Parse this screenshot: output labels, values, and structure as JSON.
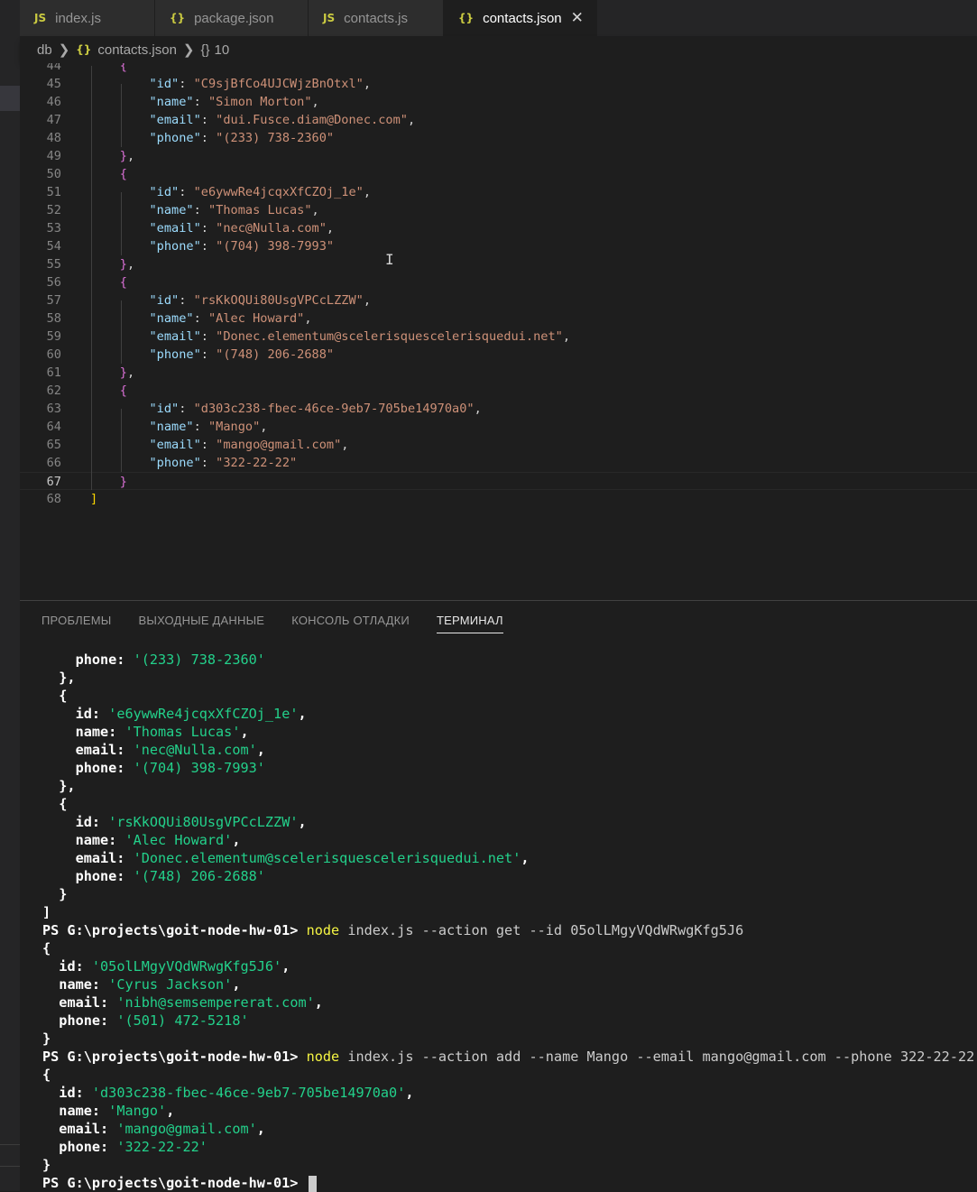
{
  "tabs": [
    {
      "icon": "JS",
      "label": "index.js",
      "active": false
    },
    {
      "icon": "{}",
      "label": "package.json",
      "active": false
    },
    {
      "icon": "JS",
      "label": "contacts.js",
      "active": false
    },
    {
      "icon": "{}",
      "label": "contacts.json",
      "active": true
    }
  ],
  "breadcrumb": {
    "folder": "db",
    "file": "contacts.json",
    "symbol_icon": "{}",
    "symbol": "10"
  },
  "editor": {
    "active_line": 67,
    "lines": [
      {
        "n": 44,
        "text": "{",
        "indent": 1
      },
      {
        "n": 45,
        "key": "id",
        "value": "C9sjBfCo4UJCWjzBnOtxl",
        "comma": true
      },
      {
        "n": 46,
        "key": "name",
        "value": "Simon Morton",
        "comma": true
      },
      {
        "n": 47,
        "key": "email",
        "value": "dui.Fusce.diam@Donec.com",
        "comma": true
      },
      {
        "n": 48,
        "key": "phone",
        "value": "(233) 738-2360",
        "comma": false
      },
      {
        "n": 49,
        "text": "},",
        "indent": 1
      },
      {
        "n": 50,
        "text": "{",
        "indent": 1
      },
      {
        "n": 51,
        "key": "id",
        "value": "e6ywwRe4jcqxXfCZOj_1e",
        "comma": true
      },
      {
        "n": 52,
        "key": "name",
        "value": "Thomas Lucas",
        "comma": true
      },
      {
        "n": 53,
        "key": "email",
        "value": "nec@Nulla.com",
        "comma": true
      },
      {
        "n": 54,
        "key": "phone",
        "value": "(704) 398-7993",
        "comma": false
      },
      {
        "n": 55,
        "text": "},",
        "indent": 1
      },
      {
        "n": 56,
        "text": "{",
        "indent": 1
      },
      {
        "n": 57,
        "key": "id",
        "value": "rsKkOQUi80UsgVPCcLZZW",
        "comma": true
      },
      {
        "n": 58,
        "key": "name",
        "value": "Alec Howard",
        "comma": true
      },
      {
        "n": 59,
        "key": "email",
        "value": "Donec.elementum@scelerisquescelerisquedui.net",
        "comma": true
      },
      {
        "n": 60,
        "key": "phone",
        "value": "(748) 206-2688",
        "comma": false
      },
      {
        "n": 61,
        "text": "},",
        "indent": 1
      },
      {
        "n": 62,
        "text": "{",
        "indent": 1
      },
      {
        "n": 63,
        "key": "id",
        "value": "d303c238-fbec-46ce-9eb7-705be14970a0",
        "comma": true
      },
      {
        "n": 64,
        "key": "name",
        "value": "Mango",
        "comma": true
      },
      {
        "n": 65,
        "key": "email",
        "value": "mango@gmail.com",
        "comma": true
      },
      {
        "n": 66,
        "key": "phone",
        "value": "322-22-22",
        "comma": false
      },
      {
        "n": 67,
        "text": "}",
        "indent": 1
      },
      {
        "n": 68,
        "text": "]",
        "indent": 0
      }
    ]
  },
  "panel": {
    "tabs": [
      "ПРОБЛЕМЫ",
      "ВЫХОДНЫЕ ДАННЫЕ",
      "КОНСОЛЬ ОТЛАДКИ",
      "ТЕРМИНАЛ"
    ],
    "active_tab": "ТЕРМИНАЛ"
  },
  "terminal": {
    "lines": [
      {
        "type": "kv",
        "indent": "    ",
        "key": "phone",
        "value": "'(233) 738-2360'",
        "comma": false
      },
      {
        "type": "plain",
        "text": "  },"
      },
      {
        "type": "plain",
        "text": "  {"
      },
      {
        "type": "kv",
        "indent": "    ",
        "key": "id",
        "value": "'e6ywwRe4jcqxXfCZOj_1e'",
        "comma": true
      },
      {
        "type": "kv",
        "indent": "    ",
        "key": "name",
        "value": "'Thomas Lucas'",
        "comma": true
      },
      {
        "type": "kv",
        "indent": "    ",
        "key": "email",
        "value": "'nec@Nulla.com'",
        "comma": true
      },
      {
        "type": "kv",
        "indent": "    ",
        "key": "phone",
        "value": "'(704) 398-7993'",
        "comma": false
      },
      {
        "type": "plain",
        "text": "  },"
      },
      {
        "type": "plain",
        "text": "  {"
      },
      {
        "type": "kv",
        "indent": "    ",
        "key": "id",
        "value": "'rsKkOQUi80UsgVPCcLZZW'",
        "comma": true
      },
      {
        "type": "kv",
        "indent": "    ",
        "key": "name",
        "value": "'Alec Howard'",
        "comma": true
      },
      {
        "type": "kv",
        "indent": "    ",
        "key": "email",
        "value": "'Donec.elementum@scelerisquescelerisquedui.net'",
        "comma": true
      },
      {
        "type": "kv",
        "indent": "    ",
        "key": "phone",
        "value": "'(748) 206-2688'",
        "comma": false
      },
      {
        "type": "plain",
        "text": "  }"
      },
      {
        "type": "plain",
        "text": "]"
      },
      {
        "type": "prompt",
        "prompt": "PS G:\\projects\\goit-node-hw-01> ",
        "cmd": "node",
        "args": " index.js --action get --id 05olLMgyVQdWRwgKfg5J6"
      },
      {
        "type": "plain",
        "text": "{"
      },
      {
        "type": "kv",
        "indent": "  ",
        "key": "id",
        "value": "'05olLMgyVQdWRwgKfg5J6'",
        "comma": true
      },
      {
        "type": "kv",
        "indent": "  ",
        "key": "name",
        "value": "'Cyrus Jackson'",
        "comma": true
      },
      {
        "type": "kv",
        "indent": "  ",
        "key": "email",
        "value": "'nibh@semsempererat.com'",
        "comma": true
      },
      {
        "type": "kv",
        "indent": "  ",
        "key": "phone",
        "value": "'(501) 472-5218'",
        "comma": false
      },
      {
        "type": "plain",
        "text": "}"
      },
      {
        "type": "prompt",
        "prompt": "PS G:\\projects\\goit-node-hw-01> ",
        "cmd": "node",
        "args": " index.js --action add --name Mango --email mango@gmail.com --phone 322-22-22"
      },
      {
        "type": "plain",
        "text": "{"
      },
      {
        "type": "kv",
        "indent": "  ",
        "key": "id",
        "value": "'d303c238-fbec-46ce-9eb7-705be14970a0'",
        "comma": true
      },
      {
        "type": "kv",
        "indent": "  ",
        "key": "name",
        "value": "'Mango'",
        "comma": true
      },
      {
        "type": "kv",
        "indent": "  ",
        "key": "email",
        "value": "'mango@gmail.com'",
        "comma": true
      },
      {
        "type": "kv",
        "indent": "  ",
        "key": "phone",
        "value": "'322-22-22'",
        "comma": false
      },
      {
        "type": "plain",
        "text": "}"
      },
      {
        "type": "prompt",
        "prompt": "PS G:\\projects\\goit-node-hw-01> ",
        "cmd": "",
        "args": "",
        "cursor": true
      }
    ]
  },
  "colors": {
    "background": "#1e1e1e",
    "json_key": "#9cdcfe",
    "json_string": "#ce9178",
    "terminal_string": "#23d18b",
    "command": "#f5f543"
  }
}
